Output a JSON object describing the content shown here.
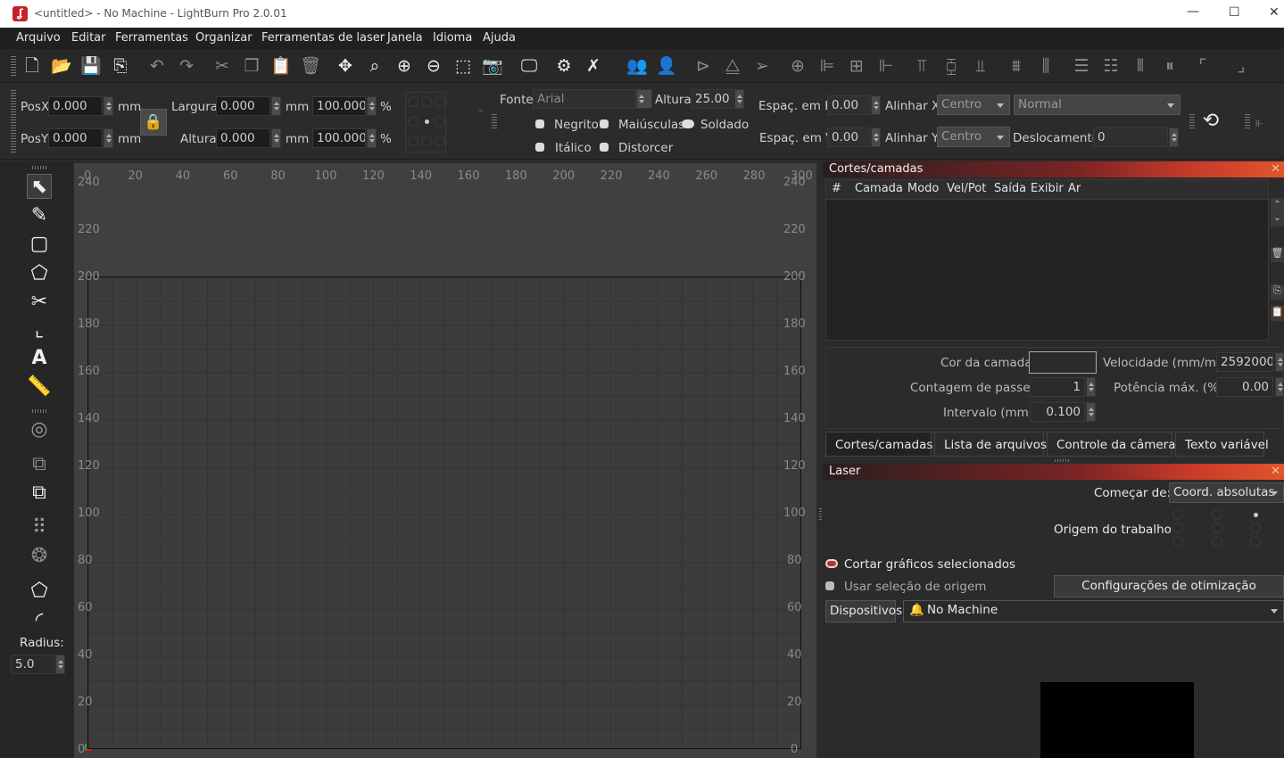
{
  "window": {
    "title": "<untitled> - No Machine - LightBurn Pro 2.0.01",
    "minimize_glyph": "—",
    "maximize_glyph": "☐",
    "close_glyph": "✕",
    "app_icon": "lightburn-logo-icon"
  },
  "menu": [
    "Arquivo",
    "Editar",
    "Ferramentas",
    "Organizar",
    "Ferramentas de laser",
    "Janela",
    "Idioma",
    "Ajuda"
  ],
  "toolbar_icons": [
    "new-file-icon",
    "open-folder-icon",
    "save-icon",
    "import-icon",
    "undo-icon",
    "redo-icon",
    "cut-icon",
    "copy-icon",
    "paste-icon",
    "delete-icon",
    "move-icon",
    "zoom-fit-icon",
    "zoom-in-icon",
    "zoom-out-icon",
    "select-region-icon",
    "camera-icon",
    "monitor-icon",
    "settings-icon",
    "tools-icon",
    "group-icon",
    "ungroup-icon",
    "mirror-h-icon",
    "mirror-v-icon",
    "send-icon",
    "target-icon",
    "align-left-icon",
    "align-hcenter-icon",
    "align-right-icon",
    "align-top-icon",
    "align-vcenter-icon",
    "align-bottom-icon",
    "distribute-h-icon",
    "distribute-v-icon",
    "dock-h-icon",
    "dock-v-icon",
    "same-width-icon",
    "same-height-icon",
    "corner-top-icon",
    "corner-bottom-icon"
  ],
  "props": {
    "posx_label": "PosX",
    "posx": "0.000",
    "posy_label": "PosY",
    "posy": "0.000",
    "mm": "mm",
    "width_label": "Largura",
    "width": "0.000",
    "height_label": "Altura",
    "height": "0.000",
    "scale_x": "100.000",
    "scale_y": "100.000",
    "pct": "%",
    "font_label": "Fonte",
    "font": "Arial",
    "text_height_label": "Altura",
    "text_height": "25.00",
    "bold": "Negrito",
    "upper": "Maiúsculas",
    "welded": "Soldado",
    "italic": "Itálico",
    "distort": "Distorcer",
    "hspace_label": "Espaç. em H",
    "hspace": "0.00",
    "vspace_label": "Espaç. em V",
    "vspace": "0.00",
    "alignx_label": "Alinhar X",
    "alignx": "Centro",
    "aligny_label": "Alinhar Y",
    "aligny": "Centro",
    "normal": "Normal",
    "offset_label": "Deslocamento",
    "offset": "0"
  },
  "left_tools": {
    "radius_label": "Radius:",
    "radius": "5.0"
  },
  "ruler": {
    "top": [
      "0",
      "20",
      "40",
      "60",
      "80",
      "100",
      "120",
      "140",
      "160",
      "180",
      "200",
      "220",
      "240",
      "260",
      "280",
      "300"
    ],
    "left": [
      "240",
      "220",
      "200",
      "180",
      "160",
      "140",
      "120",
      "100",
      "80",
      "60",
      "40",
      "20",
      "0"
    ]
  },
  "cuts": {
    "title": "Cortes/camadas",
    "columns": [
      "#",
      "Camada",
      "Modo",
      "Vel/Pot",
      "Saída",
      "Exibir",
      "Ar"
    ],
    "layer_color_label": "Cor da camada",
    "speed_label": "Velocidade (mm/m)",
    "speed": "2592000",
    "passes_label": "Contagem de passes",
    "passes": "1",
    "power_label": "Potência máx. (%)",
    "power": "0.00",
    "interval_label": "Intervalo (mm)",
    "interval": "0.100"
  },
  "tabs": [
    "Cortes/camadas",
    "Lista de arquivos",
    "Controle da câmera",
    "Texto variável"
  ],
  "laser": {
    "title": "Laser",
    "start_label": "Começar de:",
    "start": "Coord. absolutas",
    "origin_label": "Origem do trabalho",
    "cut_selected": "Cortar gráficos selecionados",
    "use_origin": "Usar seleção de origem",
    "optimize": "Configurações de otimização",
    "devices": "Dispositivos",
    "machine": "No Machine"
  }
}
